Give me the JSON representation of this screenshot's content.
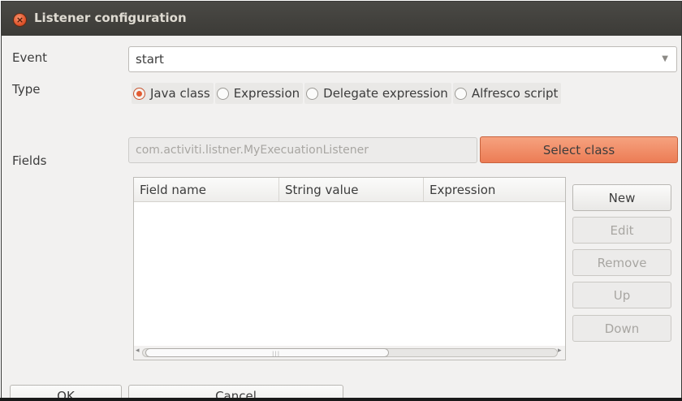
{
  "window": {
    "title": "Listener configuration",
    "close_icon": "close-icon",
    "accent_color": "#ec7c55"
  },
  "form": {
    "event_label": "Event",
    "event_value": "start",
    "type_label": "Type",
    "type_options": [
      {
        "label": "Java class",
        "checked": true
      },
      {
        "label": "Expression",
        "checked": false
      },
      {
        "label": "Delegate expression",
        "checked": false
      },
      {
        "label": "Alfresco script",
        "checked": false
      }
    ],
    "class_value": "com.activiti.listner.MyExecuationListener",
    "select_class_label": "Select class",
    "fields_label": "Fields"
  },
  "table": {
    "columns": [
      "Field name",
      "String value",
      "Expression"
    ],
    "rows": []
  },
  "buttons": {
    "new": "New",
    "edit": "Edit",
    "remove": "Remove",
    "up": "Up",
    "down": "Down",
    "ok": "OK",
    "cancel": "Cancel"
  }
}
